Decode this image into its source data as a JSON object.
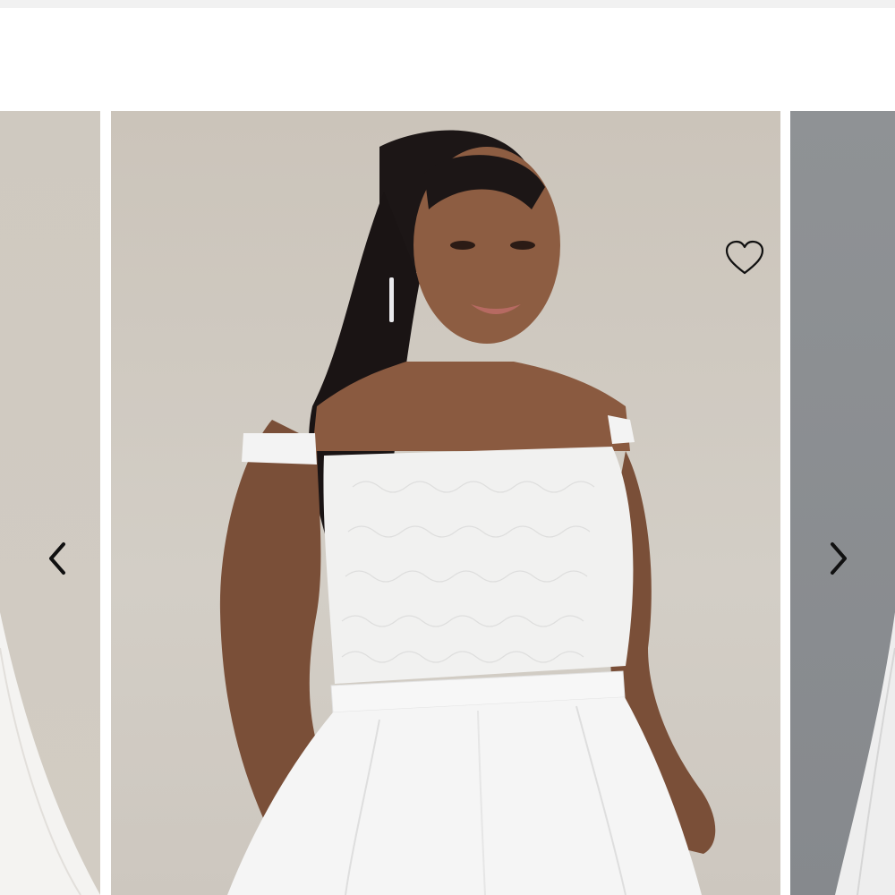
{
  "page": {
    "colors": {
      "background": "#ffffff",
      "top_strip": "#f1f1f1",
      "studio_backdrop": "#cbc4ba",
      "next_slide_backdrop": "#8f9295",
      "icon": "#111111"
    }
  },
  "carousel": {
    "favorite": {
      "icon": "heart-outline-icon",
      "selected": false
    },
    "prev_control": {
      "icon": "chevron-left-icon"
    },
    "next_control": {
      "icon": "chevron-right-icon"
    }
  }
}
